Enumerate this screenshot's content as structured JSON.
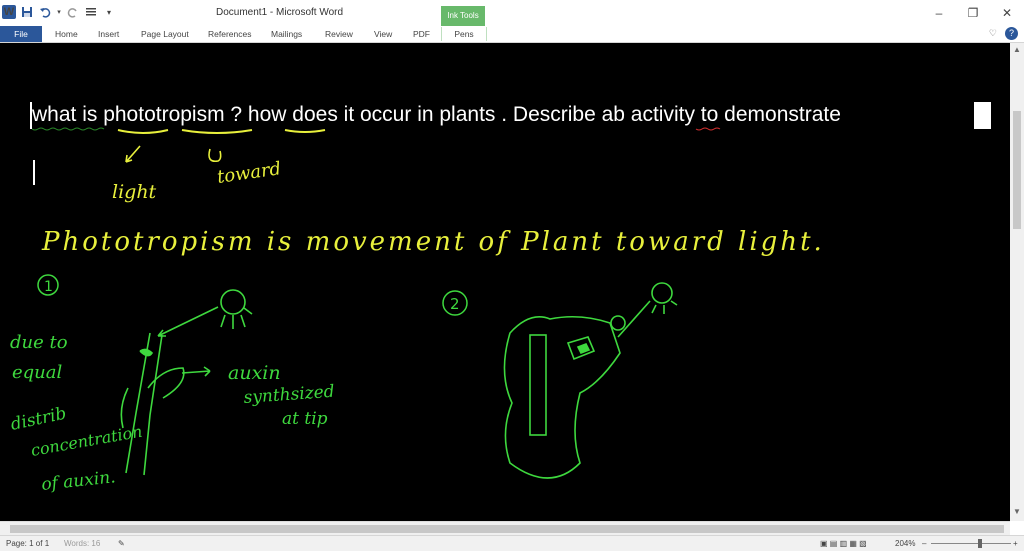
{
  "window": {
    "title": "Document1 - Microsoft Word",
    "contextual_group": "Ink Tools",
    "buttons": [
      "–",
      "❐",
      "✕"
    ]
  },
  "quick_access": {
    "app_icon": "W",
    "icons": [
      "word-logo-icon",
      "save-icon",
      "undo-icon",
      "redo-icon",
      "paragraph-icon",
      "customize-qat-icon"
    ]
  },
  "ribbon": {
    "tabs": [
      "File",
      "Home",
      "Insert",
      "Page Layout",
      "References",
      "Mailings",
      "Review",
      "View",
      "PDF",
      "Pens"
    ],
    "right_icons": [
      "collapse-ribbon-icon",
      "help-icon"
    ],
    "help_label": "?",
    "collapse_label": "♡"
  },
  "document": {
    "question_text": "what is phototropism ? how does it occur in plants . Describe ab activity to demonstrate",
    "ink_light": "light",
    "ink_toward": "toward",
    "ink_definition": "Phototropism is movement of Plant toward light.",
    "ink_one": "1",
    "ink_two": "2",
    "ink_due_to": "due to",
    "ink_equal": "equal",
    "ink_distrib": "distrib",
    "ink_concentration": "concentration",
    "ink_of_auxin": "of auxin.",
    "ink_auxin": "auxin",
    "ink_synthesized": "synthsized",
    "ink_at_tip": "at tip",
    "colors": {
      "background": "#000000",
      "question_text": "#ffffff",
      "yellow_ink": "#e8f03c",
      "green_ink": "#3ed83e"
    }
  },
  "statusbar": {
    "page": "Page: 1 of 1",
    "words": "Words: 16",
    "zoom": "204%",
    "zoom_out": "–",
    "zoom_in": "+"
  }
}
